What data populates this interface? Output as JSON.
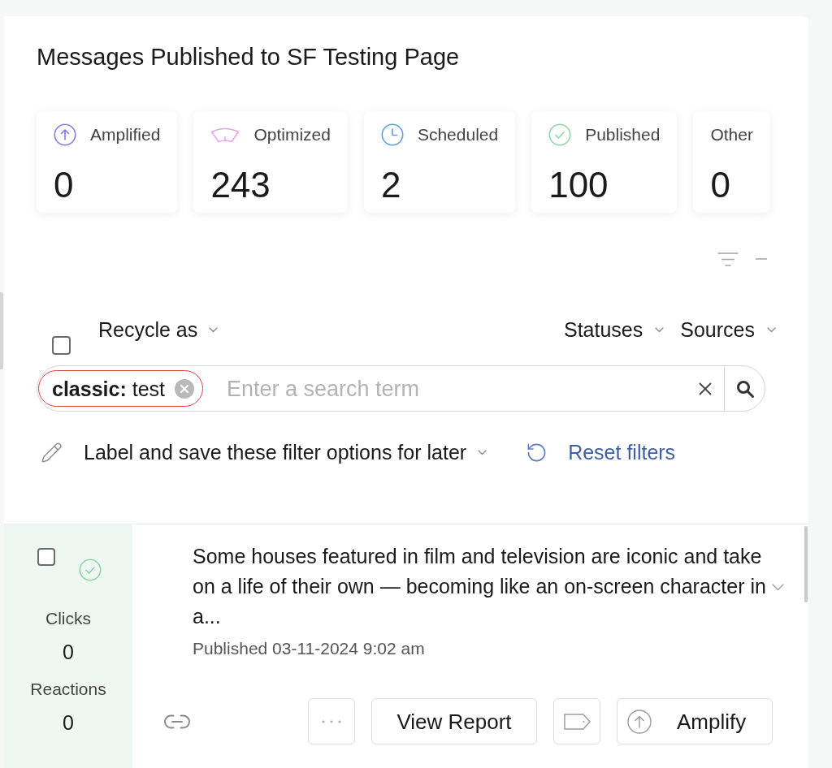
{
  "page": {
    "title": "Messages Published to SF Testing Page"
  },
  "stats": [
    {
      "kind": "amplified",
      "label": "Amplified",
      "value": "0"
    },
    {
      "kind": "optimized",
      "label": "Optimized",
      "value": "243"
    },
    {
      "kind": "scheduled",
      "label": "Scheduled",
      "value": "2"
    },
    {
      "kind": "published",
      "label": "Published",
      "value": "100"
    },
    {
      "kind": "other",
      "label": "Other",
      "value": "0"
    }
  ],
  "filters": {
    "select_all": {
      "checked": false
    },
    "recycle": {
      "label": "Recycle as"
    },
    "dropdowns": [
      {
        "label": "Statuses"
      },
      {
        "label": "Sources"
      }
    ]
  },
  "search": {
    "chips": [
      {
        "text": "**classic:** test"
      }
    ],
    "placeholder": "Enter a search term"
  },
  "saved_filters": {
    "label": "Label and save these filter options for later"
  },
  "reset": {
    "label": "Reset filters"
  },
  "messages": [
    {
      "kind": "published",
      "checked": false,
      "metrics": [
        {
          "label": "Clicks",
          "value": "0"
        },
        {
          "label": "Reactions",
          "value": "0"
        }
      ],
      "text": "Some houses featured in film and television are iconic and take on a life of their own — becoming like an on-screen character in a...",
      "timestamp": "Published 03-11-2024 9:02 am",
      "actions": [
        {
          "kind": "more"
        },
        {
          "kind": "report",
          "label": "View Report"
        },
        {
          "kind": "tag"
        },
        {
          "kind": "amplify",
          "label": "Amplify"
        }
      ]
    }
  ]
}
